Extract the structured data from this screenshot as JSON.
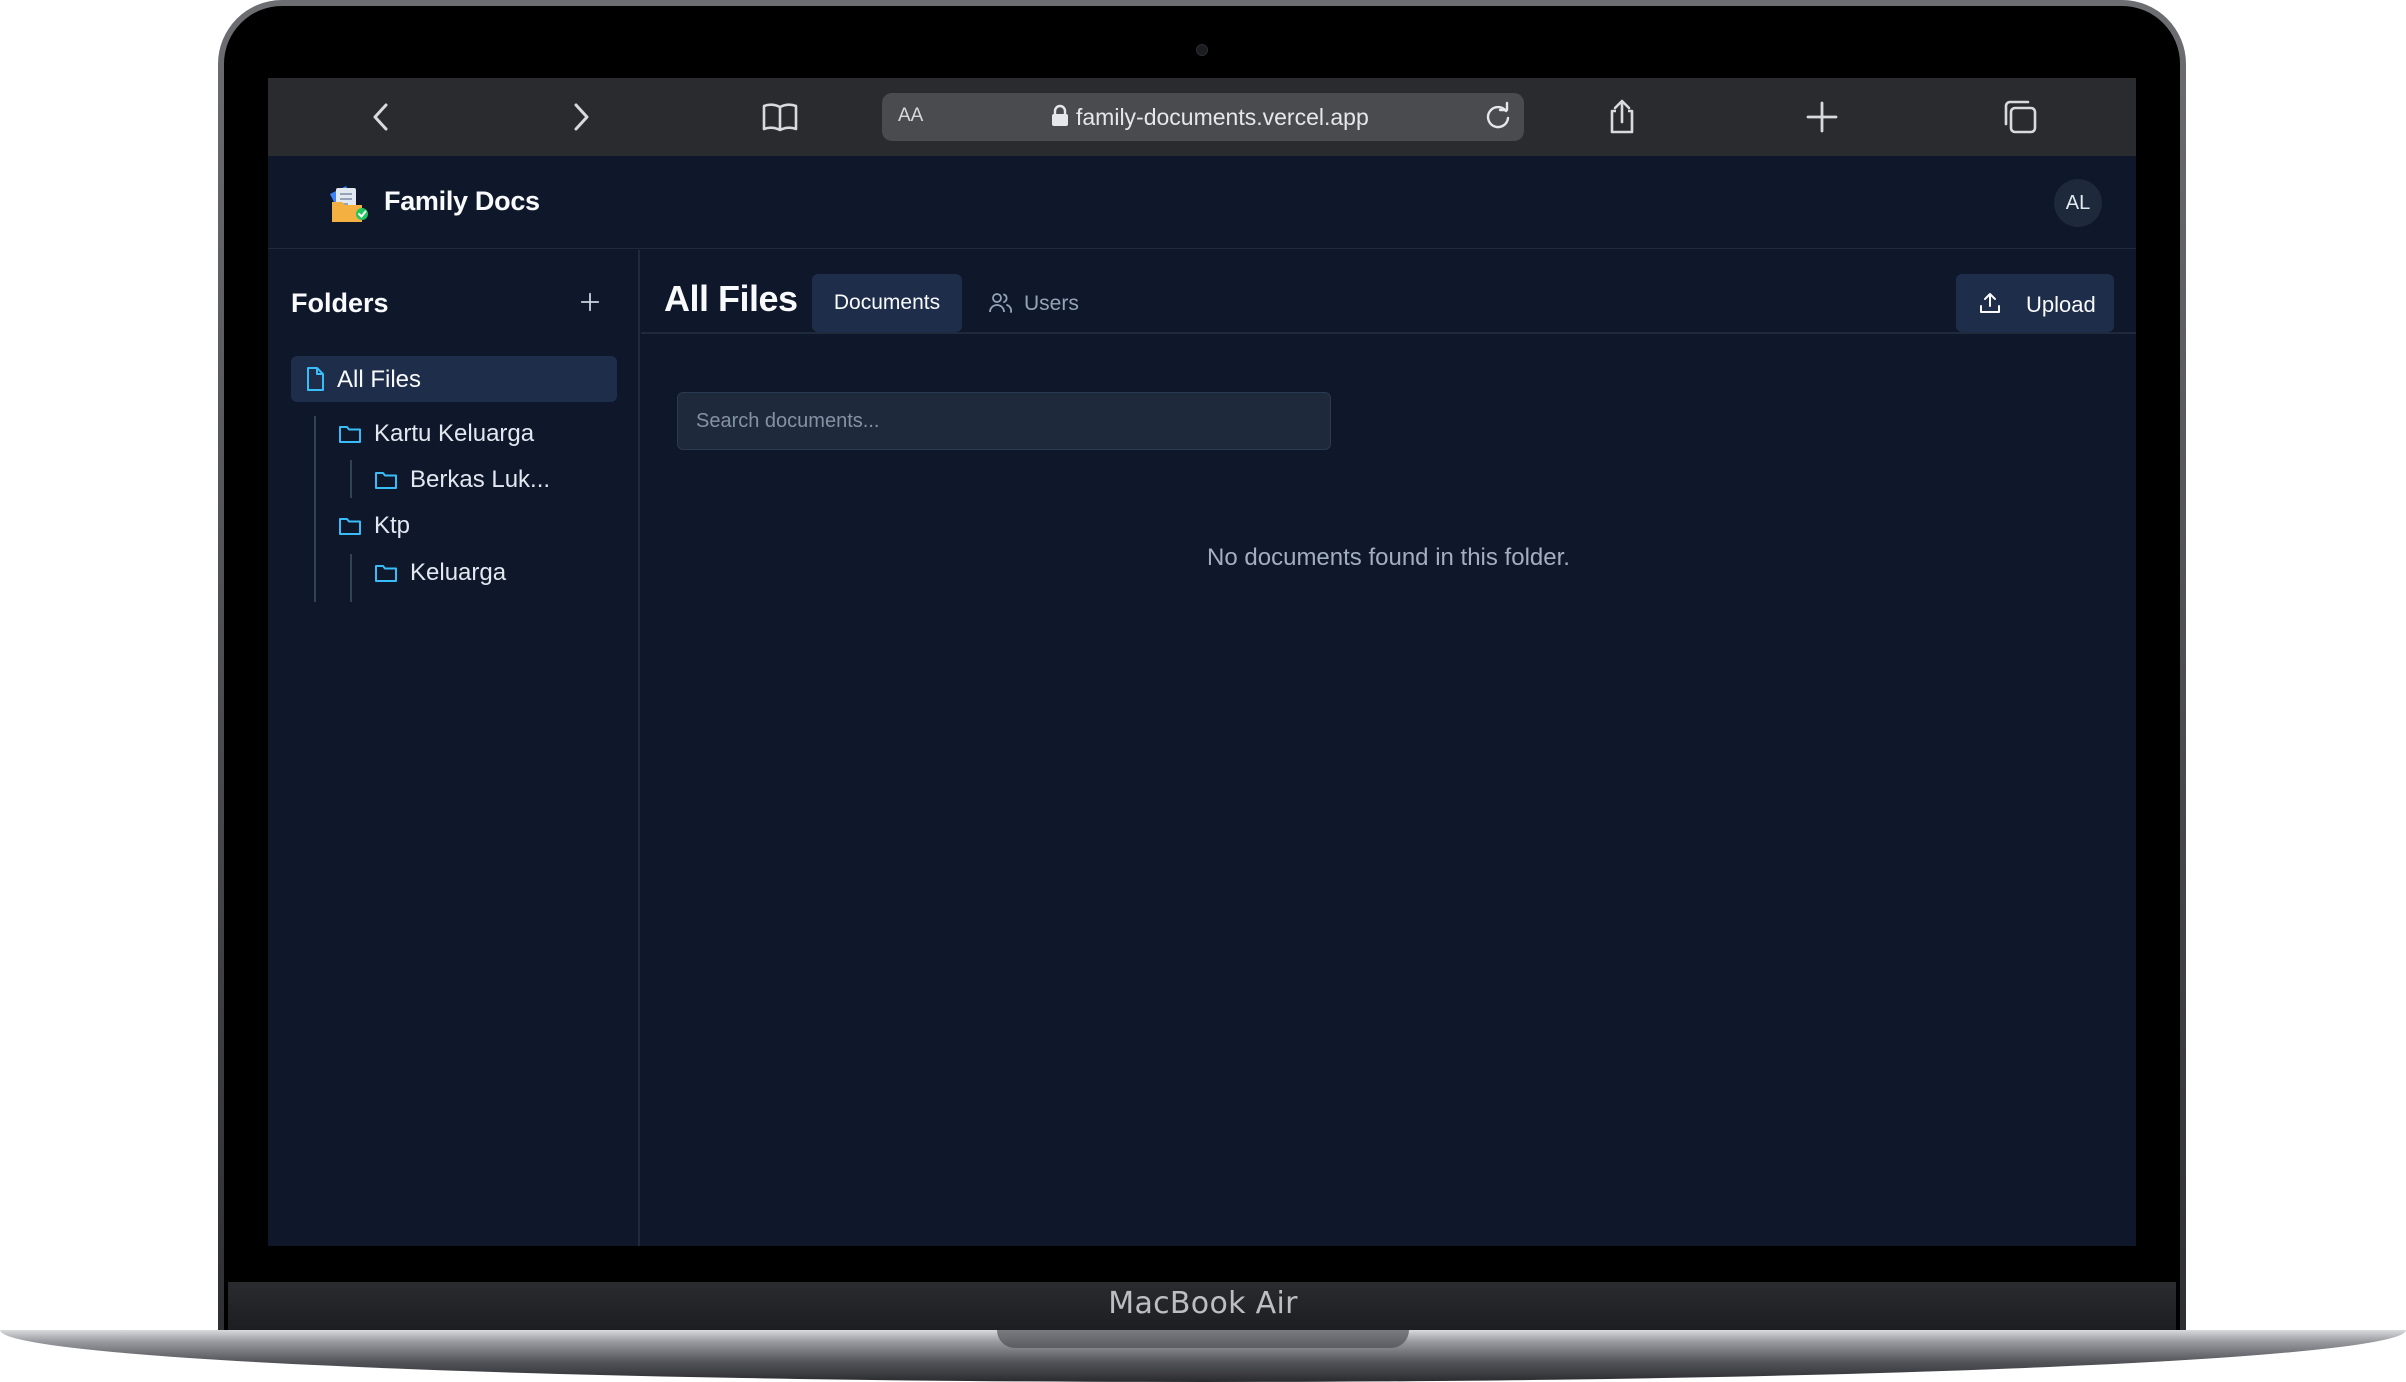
{
  "device": {
    "label": "MacBook Air"
  },
  "browser": {
    "text_size_label": "AA",
    "url": "family-documents.vercel.app",
    "icons": [
      "back-icon",
      "forward-icon",
      "bookmarks-icon",
      "lock-icon",
      "reload-icon",
      "share-icon",
      "new-tab-icon",
      "tabs-icon"
    ]
  },
  "header": {
    "app_name": "Family Docs",
    "avatar_initials": "AL"
  },
  "sidebar": {
    "title": "Folders",
    "all_files_label": "All Files",
    "folders": [
      {
        "label": "Kartu Keluarga"
      },
      {
        "label": "Berkas Luk..."
      },
      {
        "label": "Ktp"
      },
      {
        "label": "Keluarga"
      }
    ]
  },
  "main": {
    "title": "All Files",
    "tabs": [
      {
        "label": "Documents",
        "active": true
      },
      {
        "label": "Users",
        "active": false
      }
    ],
    "upload_label": "Upload",
    "search_placeholder": "Search documents...",
    "search_value": "",
    "empty_message": "No documents found in this folder."
  },
  "colors": {
    "background": "#0f172a",
    "surface": "#1e2d4a",
    "accent": "#38bdf8",
    "muted_text": "#94a3b8"
  }
}
